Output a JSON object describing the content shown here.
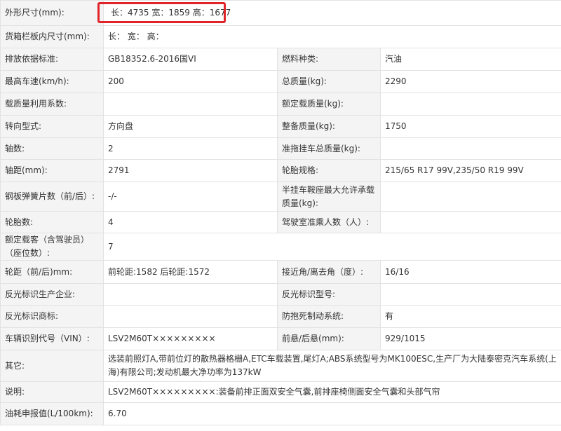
{
  "dims": {
    "label": "外形尺寸(mm):",
    "value": "长：4735 宽：1859 高：1677"
  },
  "cargo": {
    "label": "货箱栏板内尺寸(mm):",
    "value": "长：  宽：  高："
  },
  "rows": [
    [
      {
        "label": "排放依据标准:",
        "value": "GB18352.6-2016国VI"
      },
      {
        "label": "燃料种类:",
        "value": "汽油"
      }
    ],
    [
      {
        "label": "最高车速(km/h):",
        "value": "200"
      },
      {
        "label": "总质量(kg):",
        "value": "2290"
      }
    ],
    [
      {
        "label": "载质量利用系数:",
        "value": ""
      },
      {
        "label": "额定载质量(kg):",
        "value": ""
      }
    ],
    [
      {
        "label": "转向型式:",
        "value": "方向盘"
      },
      {
        "label": "整备质量(kg):",
        "value": "1750"
      }
    ],
    [
      {
        "label": "轴数:",
        "value": "2"
      },
      {
        "label": "准拖挂车总质量(kg):",
        "value": ""
      }
    ],
    [
      {
        "label": "轴距(mm):",
        "value": "2791"
      },
      {
        "label": "轮胎规格:",
        "value": "215/65 R17 99V,235/50 R19 99V"
      }
    ],
    [
      {
        "label": "钢板弹簧片数（前/后）:",
        "value": "-/-"
      },
      {
        "label": "半挂车鞍座最大允许承载质量(kg):",
        "value": ""
      }
    ],
    [
      {
        "label": "轮胎数:",
        "value": "4"
      },
      {
        "label": "驾驶室准乘人数（人）:",
        "value": ""
      }
    ],
    [
      {
        "label": "额定载客（含驾驶员）（座位数）:",
        "value": "7"
      }
    ],
    [
      {
        "label": "轮距（前/后)mm:",
        "value": "前轮距:1582 后轮距:1572"
      },
      {
        "label": "接近角/离去角（度）:",
        "value": "16/16"
      }
    ],
    [
      {
        "label": "反光标识生产企业:",
        "value": ""
      },
      {
        "label": "反光标识型号:",
        "value": ""
      }
    ],
    [
      {
        "label": "反光标识商标:",
        "value": ""
      },
      {
        "label": "防抱死制动系统:",
        "value": "有"
      }
    ],
    [
      {
        "label": "车辆识别代号（VIN）:",
        "value": "LSV2M60T×××××××××"
      },
      {
        "label": "前悬/后悬(mm):",
        "value": "929/1015"
      }
    ],
    [
      {
        "label": "其它:",
        "value": "选装前照灯A,带前位灯的散热器格栅A,ETC车载装置,尾灯A;ABS系统型号为MK100ESC,生产厂为大陆泰密克汽车系统(上海)有限公司;发动机最大净功率为137kW"
      }
    ],
    [
      {
        "label": "说明:",
        "value": "LSV2M60T×××××××××:装备前排正面双安全气囊,前排座椅侧面安全气囊和头部气帘"
      }
    ],
    [
      {
        "label": "油耗申报值(L/100km):",
        "value": "6.70"
      }
    ]
  ],
  "highlight_color": "#e0242a"
}
